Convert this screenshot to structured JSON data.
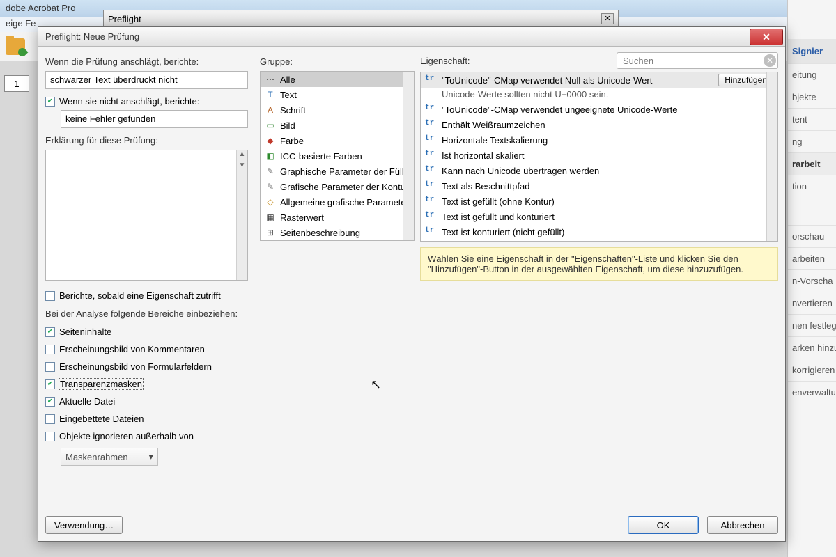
{
  "bg": {
    "app_title": "dobe Acrobat Pro",
    "menu_fragment": "eige   Fe",
    "page_number": "1",
    "preflight_window_title": "Preflight"
  },
  "right_panel": {
    "header": "Signier",
    "items": [
      "eitung",
      "bjekte",
      "tent",
      "ng"
    ],
    "section": "rarbeit",
    "section_sub": "tion",
    "links": [
      "orschau",
      "arbeiten",
      "n-Vorscha",
      "nvertieren",
      "nen festleg",
      "arken hinzu",
      "korrigieren",
      "enverwaltun"
    ]
  },
  "dialog": {
    "title": "Preflight: Neue Prüfung",
    "left": {
      "label_if_fires": "Wenn die Prüfung anschlägt, berichte:",
      "fires_text": "schwarzer Text überdruckt nicht",
      "cb_not_fires_label": "Wenn sie nicht anschlägt, berichte:",
      "not_fires_text": "keine Fehler gefunden",
      "explain_label": "Erklärung für diese Prüfung:",
      "cb_report_label": "Berichte, sobald eine Eigenschaft zutrifft",
      "include_label": "Bei der Analyse folgende Bereiche einbeziehen:",
      "cb_seiteninhalte": "Seiteninhalte",
      "cb_kommentare": "Erscheinungsbild von Kommentaren",
      "cb_formulare": "Erscheinungsbild von Formularfeldern",
      "cb_transparenz": "Transparenzmasken",
      "cb_aktuelle": "Aktuelle Datei",
      "cb_eingebettet": "Eingebettete Dateien",
      "cb_ignorieren": "Objekte ignorieren außerhalb von",
      "mask_select": "Maskenrahmen",
      "usage_btn": "Verwendung…"
    },
    "group": {
      "label": "Gruppe:",
      "items": [
        {
          "icon": "⋯",
          "label": "Alle",
          "sel": true
        },
        {
          "icon": "T",
          "label": "Text",
          "color": "#2c6fb5"
        },
        {
          "icon": "A",
          "label": "Schrift",
          "color": "#b05a1a"
        },
        {
          "icon": "▭",
          "label": "Bild",
          "color": "#3a8a3a"
        },
        {
          "icon": "◆",
          "label": "Farbe",
          "color": "#c0392b"
        },
        {
          "icon": "◧",
          "label": "ICC-basierte Farben",
          "color": "#2e8b2e"
        },
        {
          "icon": "✎",
          "label": "Graphische Parameter der Füllf",
          "color": "#777"
        },
        {
          "icon": "✎",
          "label": "Grafische Parameter der Kontu",
          "color": "#777"
        },
        {
          "icon": "◇",
          "label": "Allgemeine grafische Parameter",
          "color": "#c48a1a"
        },
        {
          "icon": "▦",
          "label": "Rasterwert",
          "color": "#333"
        },
        {
          "icon": "⊞",
          "label": "Seitenbeschreibung",
          "color": "#555"
        }
      ]
    },
    "property": {
      "label": "Eigenschaft:",
      "search_placeholder": "Suchen",
      "add_label": "Hinzufügen",
      "selected": {
        "text": "\"ToUnicode\"-CMap verwendet Null als Unicode-Wert",
        "sub": "Unicode-Werte sollten nicht U+0000 sein."
      },
      "items": [
        "\"ToUnicode\"-CMap verwendet ungeeignete Unicode-Werte",
        "Enthält Weißraumzeichen",
        "Horizontale Textskalierung",
        "Ist horizontal skaliert",
        "Kann nach Unicode übertragen werden",
        "Text als Beschnittpfad",
        "Text ist gefüllt (ohne Kontur)",
        "Text ist gefüllt und konturiert",
        "Text ist konturiert (nicht gefüllt)"
      ]
    },
    "hint": "Wählen Sie eine Eigenschaft in der \"Eigenschaften\"-Liste und klicken Sie den \"Hinzufügen\"-Button in der ausgewählten Eigenschaft, um diese hinzuzufügen.",
    "ok": "OK",
    "cancel": "Abbrechen"
  }
}
